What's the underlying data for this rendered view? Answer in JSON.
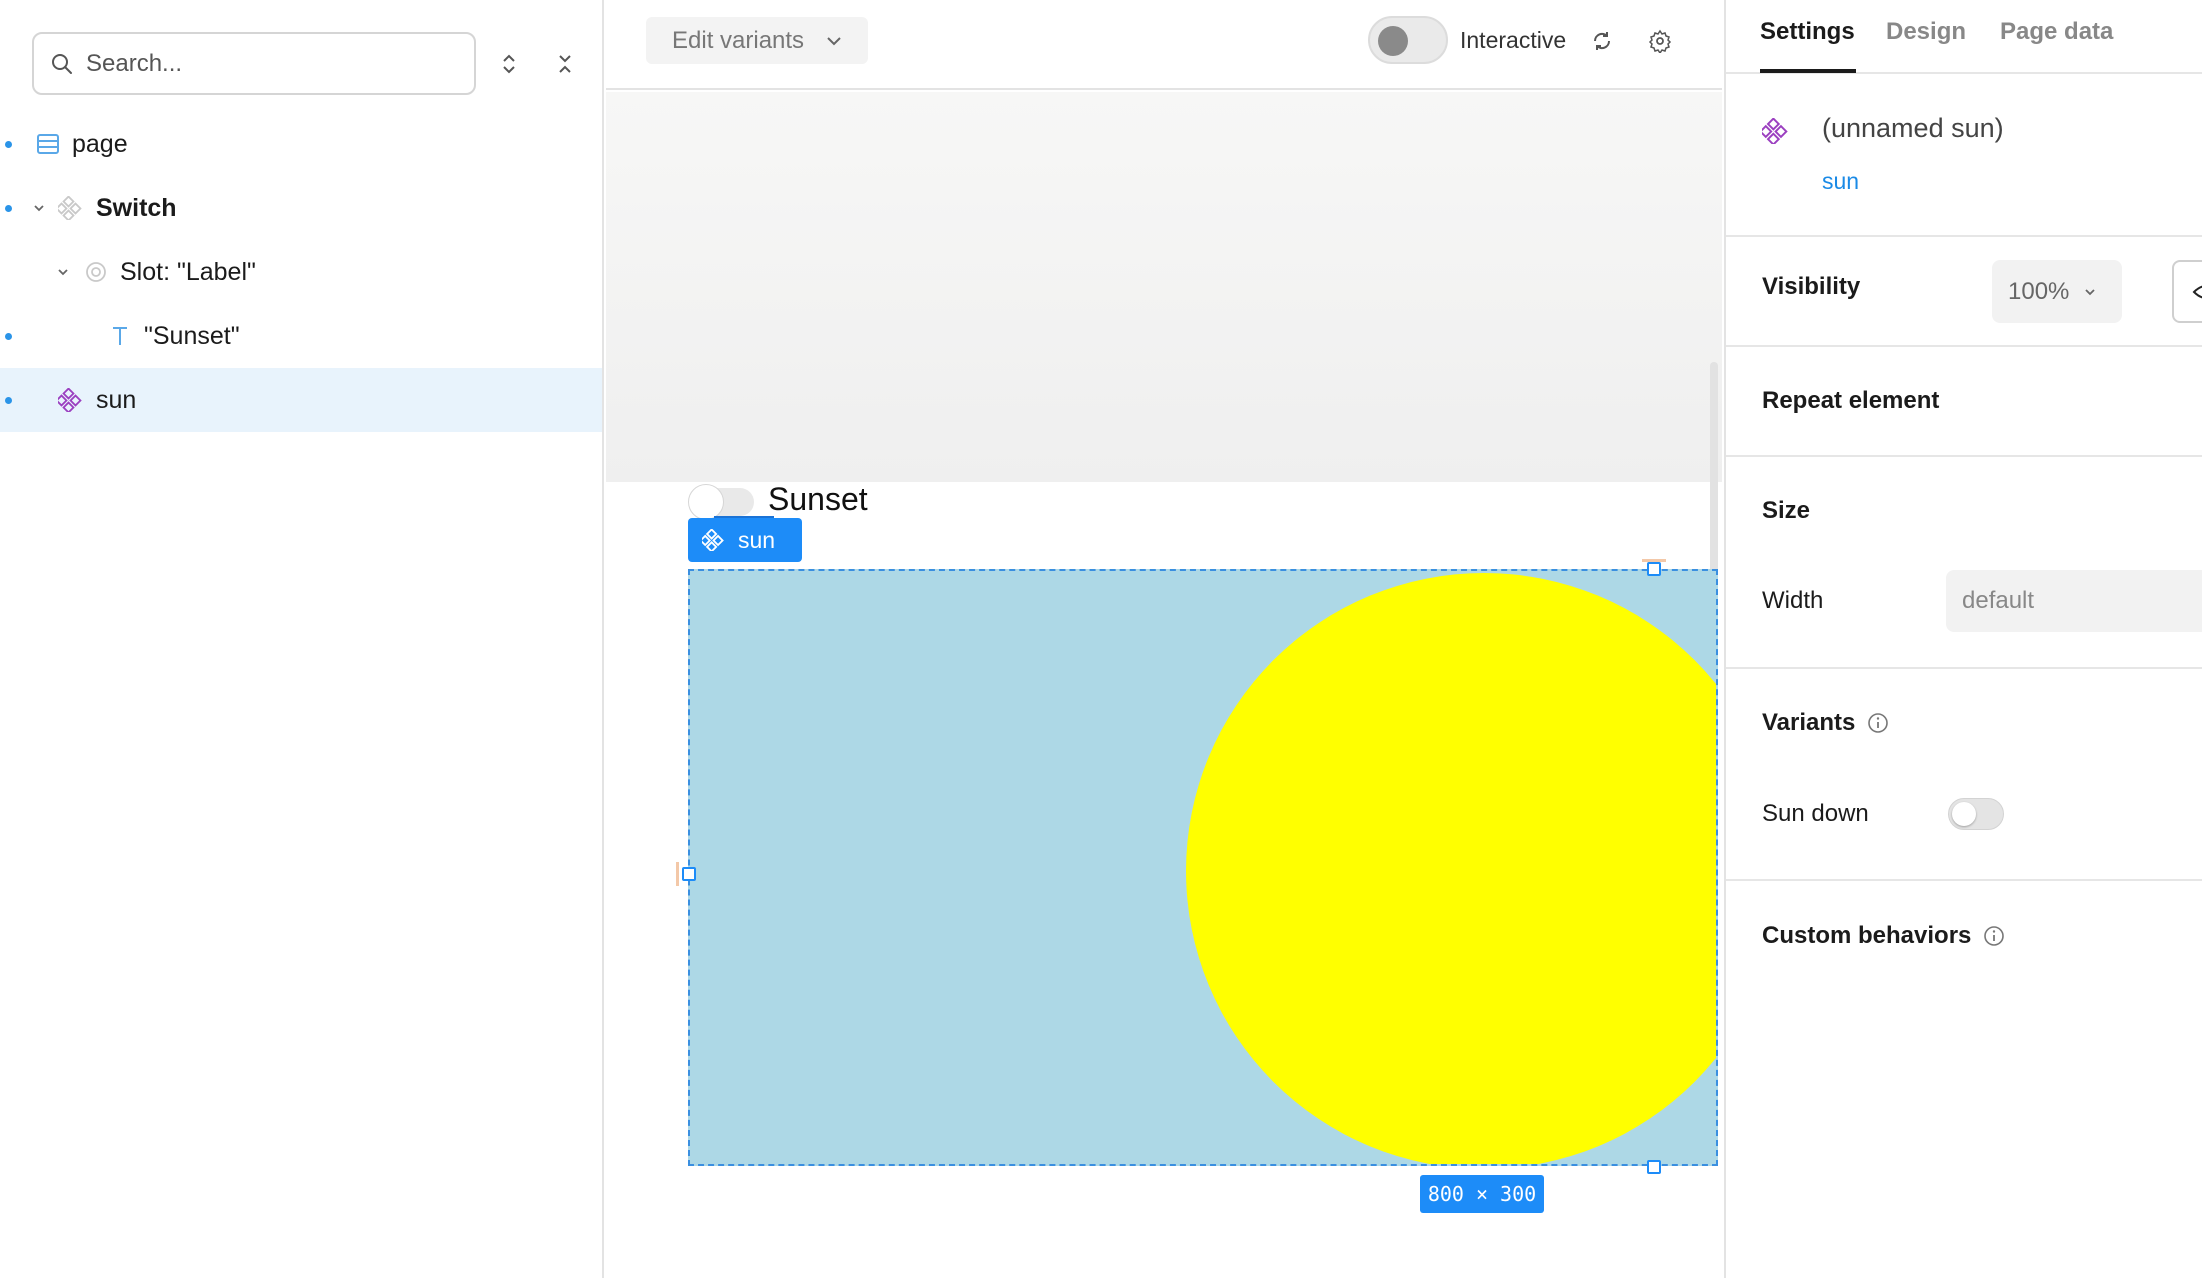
{
  "left_panel": {
    "search": {
      "placeholder": "Search..."
    },
    "tree": [
      {
        "label": "page",
        "icon": "page-icon",
        "bold": false,
        "indent": 0,
        "selected": false
      },
      {
        "label": "Switch",
        "icon": "component-icon",
        "bold": true,
        "indent": 0,
        "expanded": true,
        "selected": false
      },
      {
        "label": "Slot: \"Label\"",
        "icon": "slot-icon",
        "bold": false,
        "indent": 1,
        "expanded": true,
        "selected": false
      },
      {
        "label": "\"Sunset\"",
        "icon": "text-icon",
        "bold": false,
        "indent": 2,
        "selected": false
      },
      {
        "label": "sun",
        "icon": "component-instance-icon",
        "bold": false,
        "indent": 0,
        "selected": true
      }
    ]
  },
  "toolbar": {
    "edit_variants_label": "Edit variants",
    "interactive_label": "Interactive",
    "interactive_on": false
  },
  "canvas": {
    "switch_label": "Sunset",
    "selection_tag": "sun",
    "dimensions": "800 × 300",
    "colors": {
      "sky": "#add8e6",
      "sun": "#ffff00",
      "selection": "#1d8cf8"
    }
  },
  "right_panel": {
    "tabs": [
      "Settings",
      "Design",
      "Page data"
    ],
    "active_tab": "Settings",
    "element": {
      "name": "(unnamed sun)",
      "type": "sun"
    },
    "visibility": {
      "label": "Visibility",
      "value": "100%"
    },
    "repeat": {
      "label": "Repeat element"
    },
    "size": {
      "label": "Size",
      "width_label": "Width",
      "width_placeholder": "default"
    },
    "variants": {
      "label": "Variants",
      "sun_down_label": "Sun down",
      "sun_down_on": false
    },
    "custom_behaviors": {
      "label": "Custom behaviors"
    }
  }
}
